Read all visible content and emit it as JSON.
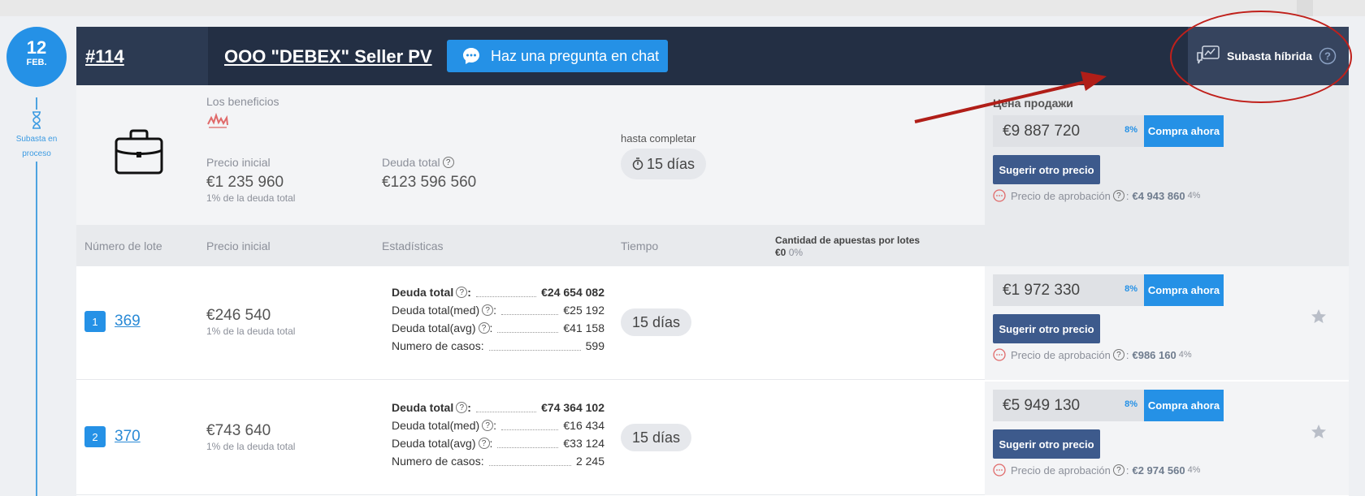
{
  "date": {
    "day": "12",
    "month": "FEB."
  },
  "status": {
    "label": "Subasta en proceso"
  },
  "header": {
    "lot_number": "#114",
    "seller": "OOO \"DEBEX\" Seller PV",
    "chat_button": "Haz una pregunta en chat",
    "hybrid_label": "Subasta híbrida",
    "hybrid_help": "?"
  },
  "summary": {
    "benefits_label": "Los beneficios",
    "initial_price_label": "Precio inicial",
    "initial_price": "€1 235 960",
    "initial_price_note": "1% de la deuda total",
    "total_debt_label": "Deuda total",
    "total_debt": "€123 596 560",
    "until_label": "hasta completar",
    "time_left": "15 días",
    "sale_price_label": "Цена продажи",
    "sale_price": "€9 887 720",
    "sale_pct": "8%",
    "buy_now": "Compra ahora",
    "suggest": "Sugerir otro precio",
    "approval_label": "Precio de aprobación",
    "approval_value": "€4 943 860",
    "approval_pct": "4%"
  },
  "columns": {
    "lot_number": "Número de lote",
    "initial_price": "Precio inicial",
    "stats": "Estadísticas",
    "time": "Tiempo",
    "bids_label": "Cantidad de apuestas por lotes",
    "bids_value": "€0",
    "bids_pct": "0%"
  },
  "lots": [
    {
      "index": "1",
      "lot": "369",
      "initial_price": "€246 540",
      "initial_note": "1% de la deuda total",
      "stats": {
        "total_label": "Deuda total",
        "total": "€24 654 082",
        "med_label": "Deuda total(med)",
        "med": "€25 192",
        "avg_label": "Deuda total(avg)",
        "avg": "€41 158",
        "cases_label": "Numero de casos:",
        "cases": "599"
      },
      "time": "15 días",
      "price": "€1 972 330",
      "pct": "8%",
      "buy_now": "Compra ahora",
      "suggest": "Sugerir otro precio",
      "approval_label": "Precio de aprobación",
      "approval_value": "€986 160",
      "approval_pct": "4%"
    },
    {
      "index": "2",
      "lot": "370",
      "initial_price": "€743 640",
      "initial_note": "1% de la deuda total",
      "stats": {
        "total_label": "Deuda total",
        "total": "€74 364 102",
        "med_label": "Deuda total(med)",
        "med": "€16 434",
        "avg_label": "Deuda total(avg)",
        "avg": "€33 124",
        "cases_label": "Numero de casos:",
        "cases": "2 245"
      },
      "time": "15 días",
      "price": "€5 949 130",
      "pct": "8%",
      "buy_now": "Compra ahora",
      "suggest": "Sugerir otro precio",
      "approval_label": "Precio de aprobación",
      "approval_value": "€2 974 560",
      "approval_pct": "4%"
    }
  ],
  "colors": {
    "accent": "#2591e6",
    "header_bg": "#232f44",
    "suggest_bg": "#3d5a8c",
    "annotation": "#c0201b"
  }
}
